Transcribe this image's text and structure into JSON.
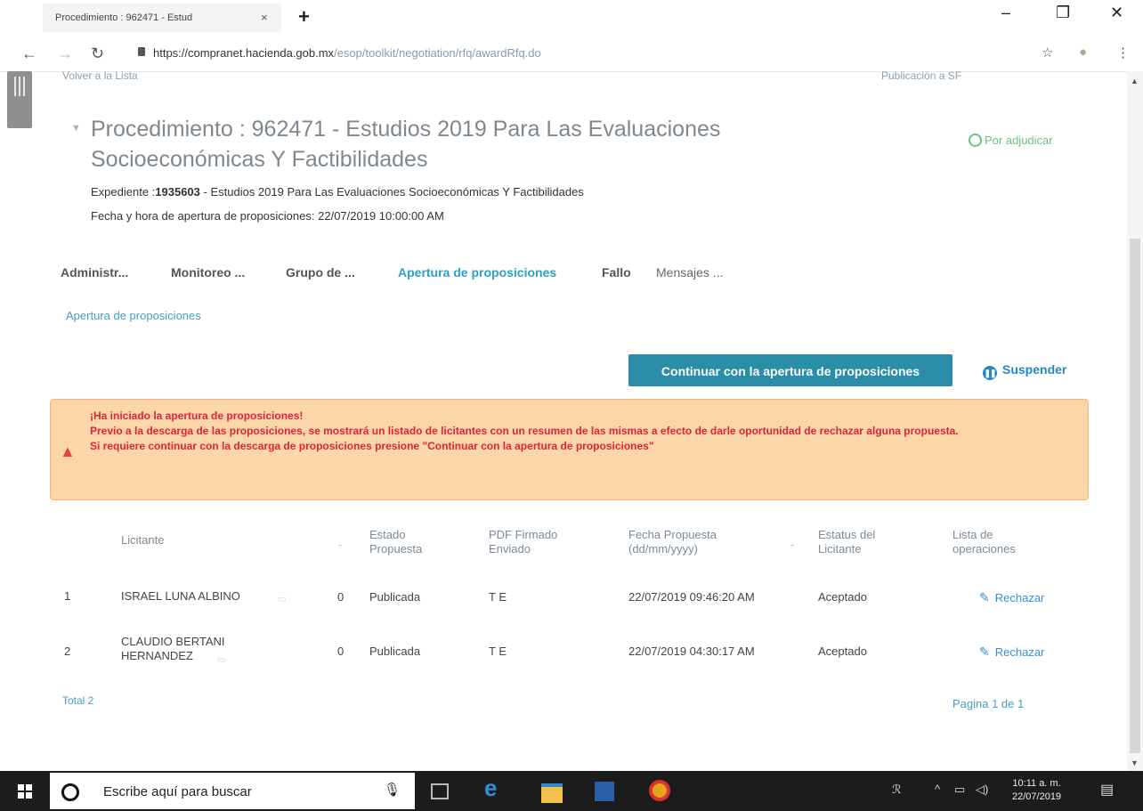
{
  "browser": {
    "tab_title": "Procedimiento : 962471 - Estud",
    "tab_close": "×",
    "new_tab": "+",
    "url_host": "https://compranet.hacienda.gob.mx",
    "url_path": "/esop/toolkit/negotiation/rfq/awardRfq.do",
    "window_controls": [
      "–",
      "❐",
      "✕"
    ]
  },
  "page": {
    "back_to_list_cut": "Volver a la Lista",
    "top_right_cut": "Publicación a SF",
    "title": "Procedimiento : 962471 - Estudios 2019 Para Las Evaluaciones Socioeconómicas Y Factibilidades",
    "status": "Por adjudicar",
    "expediente_label": "Expediente :",
    "expediente_number": "1935603",
    "expediente_desc": " - Estudios 2019 Para Las Evaluaciones Socioeconómicas Y Factibilidades",
    "apertura_label": "Fecha y hora de apertura de proposiciones",
    "apertura_value": "22/07/2019 10:00:00 AM"
  },
  "tabs": [
    {
      "label": "Administr...",
      "active": false
    },
    {
      "label": "Monitoreo ...",
      "active": false
    },
    {
      "label": "Grupo de ...",
      "active": false
    },
    {
      "label": "Apertura de proposiciones",
      "active": true
    },
    {
      "label": "Fallo",
      "active": false
    },
    {
      "label": "Mensajes ...",
      "active": false
    }
  ],
  "breadcrumb": "Apertura de proposiciones",
  "actions": {
    "continue_label": "Continuar con la apertura de proposiciones",
    "suspend_label": "Suspender"
  },
  "alert": {
    "line1": "¡Ha iniciado la apertura de proposiciones!",
    "line2": "Previo a la descarga de las proposiciones, se mostrará un listado de licitantes con un resumen de las mismas a efecto de darle oportunidad de rechazar alguna propuesta.",
    "line3": "Si requiere continuar con la descarga de proposiciones presione \"Continuar con la apertura de proposiciones\""
  },
  "table": {
    "headers": {
      "licitante": "Licitante",
      "estado": "Estado Propuesta",
      "pdf": "PDF Firmado Enviado",
      "fecha": "Fecha Propuesta (dd/mm/yyyy)",
      "estatus": "Estatus del Licitante",
      "operaciones": "Lista de operaciones"
    },
    "rows": [
      {
        "num": "1",
        "licitante": "ISRAEL LUNA ALBINO",
        "count": "0",
        "estado": "Publicada",
        "pdf": "T E",
        "fecha": "22/07/2019 09:46:20 AM",
        "estatus": "Aceptado",
        "op": "Rechazar"
      },
      {
        "num": "2",
        "licitante": "CLAUDIO BERTANI HERNANDEZ",
        "count": "0",
        "estado": "Publicada",
        "pdf": "T E",
        "fecha": "22/07/2019 04:30:17 AM",
        "estatus": "Aceptado",
        "op": "Rechazar"
      }
    ],
    "total": "Total 2",
    "pagination": "Pagina 1 de 1"
  },
  "taskbar": {
    "search_placeholder": "Escribe aquí para buscar",
    "time": "10:11 a. m.",
    "date": "22/07/2019"
  },
  "colors": {
    "accent": "#2b8ea8",
    "link": "#4a9dc0",
    "alert_bg": "#fbd6a8",
    "alert_text": "#e0233a",
    "status_green": "#6cc07f"
  }
}
